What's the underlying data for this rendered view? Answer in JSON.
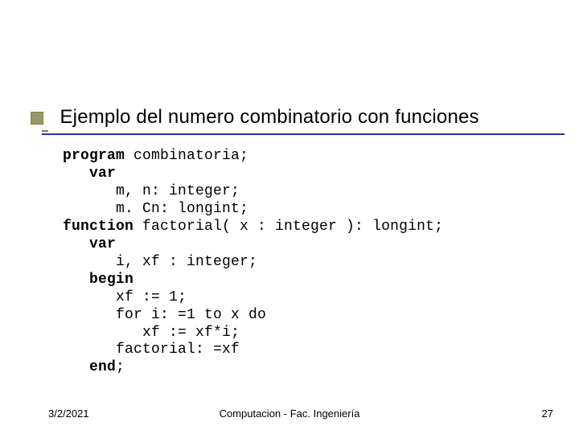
{
  "title": "Ejemplo del numero combinatorio con funciones",
  "code": {
    "l01a": "program",
    "l01b": " combinatoria;",
    "l02a": "   var",
    "l03": "      m, n: integer;",
    "l04": "      m. Cn: longint;",
    "l05a": "function",
    "l05b": " factorial( x : integer ): longint;",
    "l06a": "   var",
    "l07": "      i, xf : integer;",
    "l08a": "   begin",
    "l09": "      xf := 1;",
    "l10": "      for i: =1 to x do",
    "l11": "         xf := xf*i;",
    "l12": "      factorial: =xf",
    "l13a": "   end",
    "l13b": ";"
  },
  "footer": {
    "date": "3/2/2021",
    "center": "Computacion  - Fac. Ingeniería",
    "page": "27"
  }
}
